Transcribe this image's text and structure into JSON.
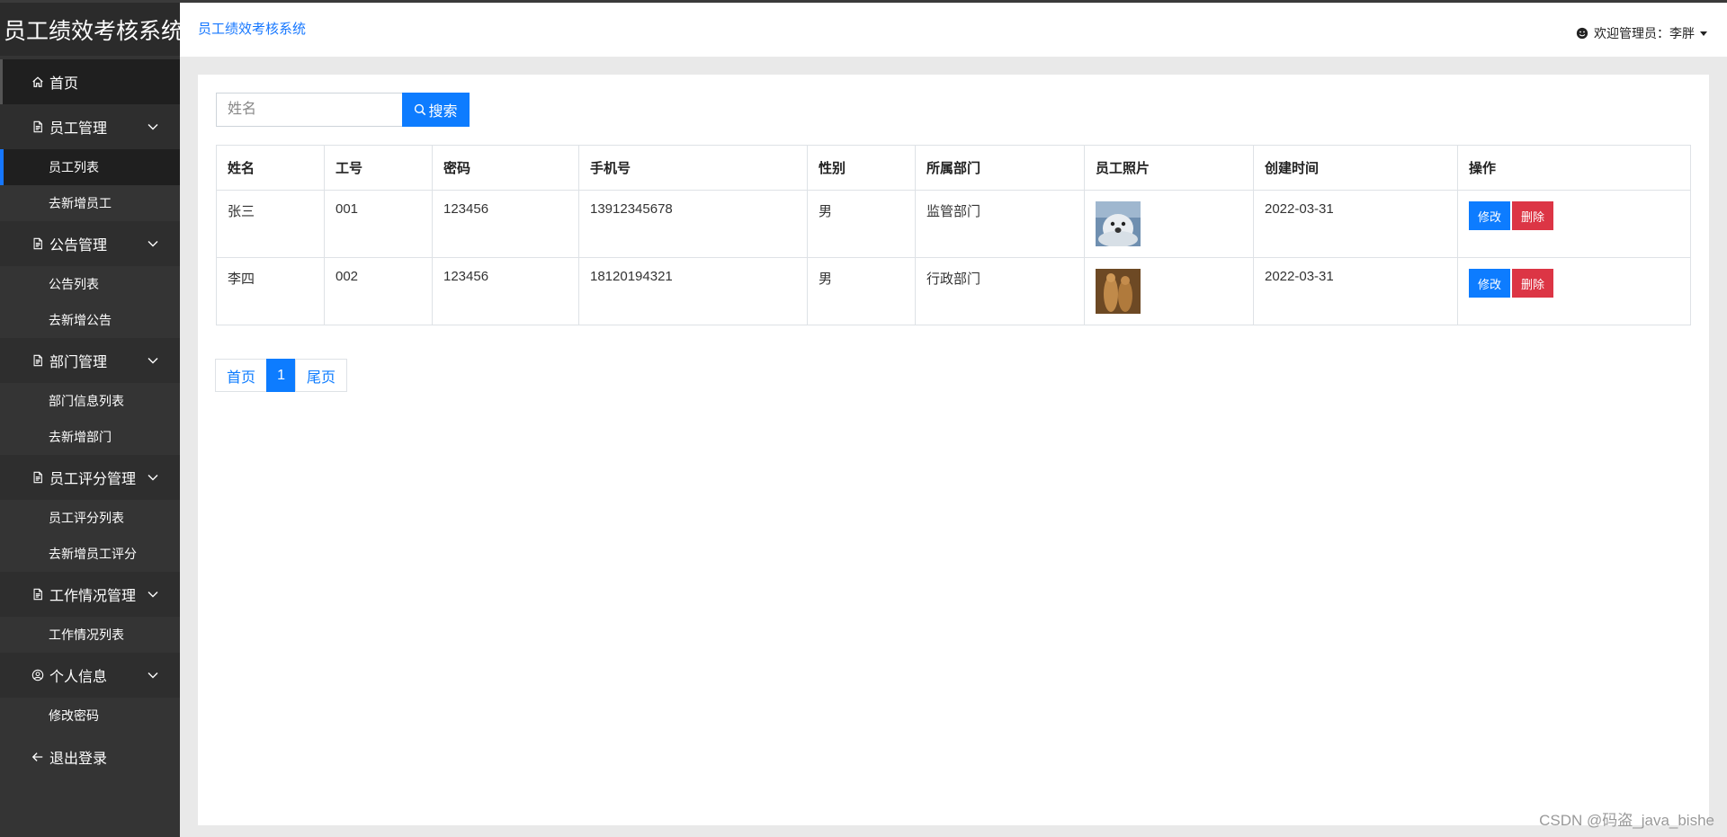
{
  "sidebar": {
    "brand": "员工绩效考核系统",
    "home": "首页",
    "groups": [
      {
        "label": "员工管理",
        "items": [
          "员工列表",
          "去新增员工"
        ]
      },
      {
        "label": "公告管理",
        "items": [
          "公告列表",
          "去新增公告"
        ]
      },
      {
        "label": "部门管理",
        "items": [
          "部门信息列表",
          "去新增部门"
        ]
      },
      {
        "label": "员工评分管理",
        "items": [
          "员工评分列表",
          "去新增员工评分"
        ]
      },
      {
        "label": "工作情况管理",
        "items": [
          "工作情况列表"
        ]
      },
      {
        "label": "个人信息",
        "items": [
          "修改密码"
        ]
      }
    ],
    "active_item": "员工列表",
    "logout": "退出登录"
  },
  "header": {
    "breadcrumb": "员工绩效考核系统",
    "user_greeting": "欢迎管理员：李胖"
  },
  "search": {
    "placeholder": "姓名",
    "value": "",
    "button_label": "搜索"
  },
  "table": {
    "columns": [
      "姓名",
      "工号",
      "密码",
      "手机号",
      "性别",
      "所属部门",
      "员工照片",
      "创建时间",
      "操作"
    ],
    "rows": [
      {
        "name": "张三",
        "id": "001",
        "password": "123456",
        "phone": "13912345678",
        "gender": "男",
        "dept": "监管部门",
        "photo": "seal-photo",
        "created": "2022-03-31"
      },
      {
        "name": "李四",
        "id": "002",
        "password": "123456",
        "phone": "18120194321",
        "gender": "男",
        "dept": "行政部门",
        "photo": "meerkat-photo",
        "created": "2022-03-31"
      }
    ],
    "edit_label": "修改",
    "delete_label": "删除"
  },
  "pagination": {
    "first": "首页",
    "current": "1",
    "last": "尾页"
  },
  "watermark": "CSDN @码盗_java_bishe",
  "colors": {
    "primary": "#0d7cff",
    "danger": "#dc3545",
    "sidebar_bg": "#343434"
  }
}
